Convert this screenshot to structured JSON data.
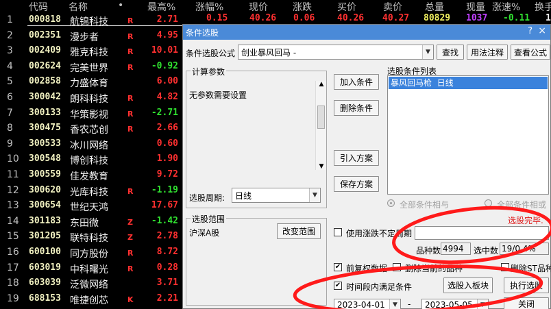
{
  "table": {
    "headers": {
      "code": "代码",
      "name": "名称",
      "dot": "•",
      "max_pct": "最高%",
      "chg_pct": "涨幅%",
      "price": "现价",
      "chg": "涨跌",
      "bid": "买价",
      "ask": "卖价",
      "vol": "总量",
      "cur": "现量",
      "speed": "涨速%",
      "turn": "换手"
    },
    "rows": [
      {
        "idx": "1",
        "code": "000818",
        "name": "航锦科技",
        "flag": "R",
        "price": "2.71",
        "color": "#ff3030"
      },
      {
        "idx": "2",
        "code": "002351",
        "name": "漫步者",
        "flag": "R",
        "price": "4.95",
        "color": "#ff3030"
      },
      {
        "idx": "3",
        "code": "002409",
        "name": "雅克科技",
        "flag": "R",
        "price": "10.01",
        "color": "#ff3030"
      },
      {
        "idx": "4",
        "code": "002624",
        "name": "完美世界",
        "flag": "R",
        "price": "-0.92",
        "color": "#30e030"
      },
      {
        "idx": "5",
        "code": "002858",
        "name": "力盛体育",
        "flag": "",
        "price": "6.00",
        "color": "#ff3030"
      },
      {
        "idx": "6",
        "code": "300042",
        "name": "朗科科技",
        "flag": "R",
        "price": "4.82",
        "color": "#ff3030"
      },
      {
        "idx": "7",
        "code": "300133",
        "name": "华策影视",
        "flag": "R",
        "price": "-2.71",
        "color": "#30e030"
      },
      {
        "idx": "8",
        "code": "300475",
        "name": "香农芯创",
        "flag": "R",
        "price": "2.66",
        "color": "#ff3030"
      },
      {
        "idx": "9",
        "code": "300533",
        "name": "冰川网络",
        "flag": "",
        "price": "0.60",
        "color": "#ff3030"
      },
      {
        "idx": "10",
        "code": "300548",
        "name": "博创科技",
        "flag": "",
        "price": "1.90",
        "color": "#ff3030"
      },
      {
        "idx": "11",
        "code": "300559",
        "name": "佳发教育",
        "flag": "",
        "price": "9.72",
        "color": "#ff3030"
      },
      {
        "idx": "12",
        "code": "300620",
        "name": "光库科技",
        "flag": "R",
        "price": "-1.19",
        "color": "#30e030"
      },
      {
        "idx": "13",
        "code": "300654",
        "name": "世纪天鸿",
        "flag": "",
        "price": "17.67",
        "color": "#ff3030"
      },
      {
        "idx": "14",
        "code": "301183",
        "name": "东田微",
        "flag": "Z",
        "price": "-1.42",
        "color": "#30e030"
      },
      {
        "idx": "15",
        "code": "301205",
        "name": "联特科技",
        "flag": "Z",
        "price": "2.78",
        "color": "#ff3030"
      },
      {
        "idx": "16",
        "code": "600100",
        "name": "同方股份",
        "flag": "R",
        "price": "8.72",
        "color": "#ff3030"
      },
      {
        "idx": "17",
        "code": "603019",
        "name": "中科曙光",
        "flag": "R",
        "price": "0.28",
        "color": "#ff3030"
      },
      {
        "idx": "18",
        "code": "603039",
        "name": "泛微网络",
        "flag": "",
        "price": "3.71",
        "color": "#ff3030"
      },
      {
        "idx": "19",
        "code": "688153",
        "name": "唯捷创芯",
        "flag": "K",
        "price": "2.21",
        "color": "#ff3030"
      }
    ],
    "row1_ext": {
      "chg_pct": "0.15",
      "price": "40.26",
      "chg": "0.06",
      "bid": "40.26",
      "ask": "40.27",
      "vol": "80829",
      "cur": "1037",
      "speed": "-0.11",
      "turn": "1"
    }
  },
  "dialog": {
    "title": "条件选股",
    "help": "?",
    "close": "×",
    "formula_label": "条件选股公式",
    "formula_value": "创业暴风回马 -",
    "btn_find": "查找",
    "btn_usage": "用法注释",
    "btn_view": "查看公式",
    "calc_params_label": "计算参数",
    "calc_params_text": "无参数需要设置",
    "btn_add": "加入条件",
    "btn_delete": "删除条件",
    "btn_import": "引入方案",
    "btn_save": "保存方案",
    "cond_list_label": "选股条件列表",
    "cond_list_items": [
      "暴风回马枪  日线"
    ],
    "period_label": "选股周期:",
    "period_value": "日线",
    "radio_and": "全部条件相与",
    "radio_or": "全部条件相或",
    "scope_label": "选股范围",
    "scope_value": "沪深A股",
    "btn_change_scope": "改变范围",
    "pick_done": "选股完毕.",
    "use_flex_label": "使用涨跌不定周期",
    "count_label": "品种数",
    "count_value": "4994",
    "selected_label": "选中数",
    "selected_value": "19/0.4%",
    "fq_label": "前复权数据",
    "del_current_label": "删除当前的品种",
    "del_st_label": "删除ST品种",
    "time_cond_label": "时间段内满足条件",
    "btn_to_sector": "选股入板块",
    "btn_exec": "执行选股",
    "date_from": "2023-04-01",
    "date_sep": "-",
    "date_to": "2023-05-05",
    "btn_close": "关闭"
  }
}
